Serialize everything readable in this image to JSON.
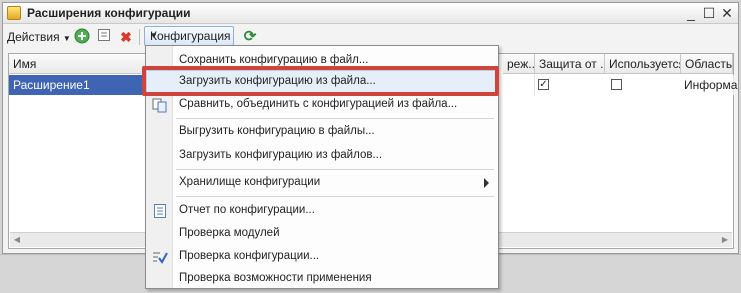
{
  "window": {
    "title": "Расширения конфигурации",
    "minimize": "_",
    "maximize": "☐",
    "close": "✕"
  },
  "toolbar": {
    "actions_label": "Действия",
    "add_icon": "plus-circle-icon",
    "edit_icon": "edit-icon",
    "delete_icon": "delete-x-icon",
    "configuration_label": "Конфигурация",
    "refresh_icon": "refresh-icon"
  },
  "grid": {
    "columns": [
      "Имя",
      "реж...",
      "Защита от ...",
      "Используется",
      "Область ..."
    ],
    "rows": [
      {
        "name": "Расширение1",
        "protection": true,
        "used": false,
        "area": "Информа"
      }
    ]
  },
  "menu": {
    "items": [
      {
        "label": "Сохранить конфигурацию в файл...",
        "icon": ""
      },
      {
        "label": "Загрузить конфигурацию из файла...",
        "icon": "",
        "highlighted": true
      },
      {
        "label": "Сравнить, объединить с конфигурацией из файла...",
        "icon": "compare-icon"
      },
      {
        "label": "Выгрузить конфигурацию в файлы...",
        "icon": ""
      },
      {
        "label": "Загрузить конфигурацию из файлов...",
        "icon": ""
      },
      {
        "label": "Хранилище конфигурации",
        "icon": "",
        "submenu": true
      },
      {
        "label": "Отчет по конфигурации...",
        "icon": "report-icon"
      },
      {
        "label": "Проверка модулей",
        "icon": ""
      },
      {
        "label": "Проверка конфигурации...",
        "icon": "check-config-icon"
      },
      {
        "label": "Проверка возможности применения",
        "icon": ""
      }
    ]
  },
  "colors": {
    "highlight_box": "#d0453b",
    "selection": "#3f64b4",
    "menu_hover": "#e6eef9"
  }
}
